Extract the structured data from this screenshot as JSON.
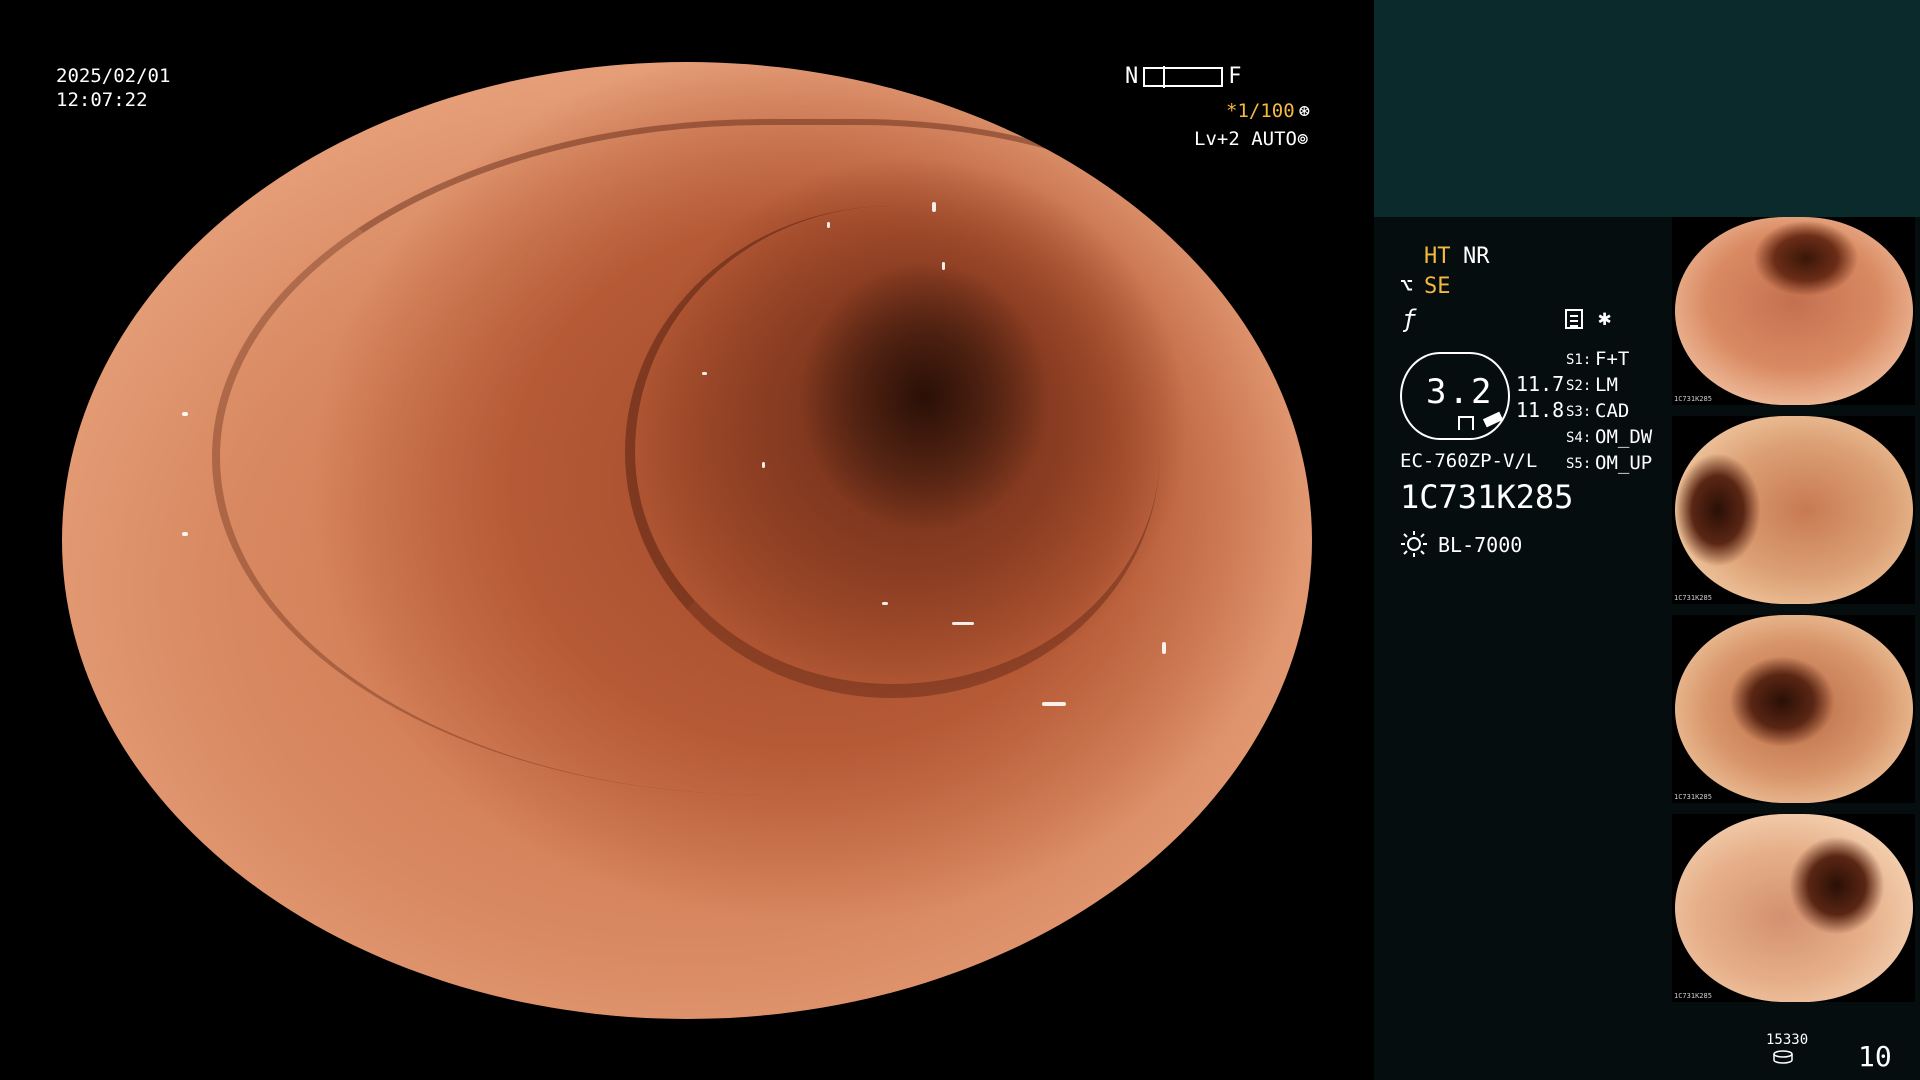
{
  "overlay": {
    "date": "2025/02/01",
    "time": "12:07:22",
    "near_label": "N",
    "far_label": "F",
    "shutter": "*1/100",
    "level": "Lv+2",
    "auto": "AUTO"
  },
  "status": {
    "ht": "HT",
    "nr": "NR",
    "se": "SE",
    "gauge_value": "3.2",
    "value_top": "11.7",
    "value_bottom": "11.8",
    "scope_model": "EC-760ZP-V/L",
    "serial": "1C731K285",
    "light_source": "BL-7000"
  },
  "switches": [
    {
      "key": "S1:",
      "value": "F+T"
    },
    {
      "key": "S2:",
      "value": "LM"
    },
    {
      "key": "S3:",
      "value": "CAD"
    },
    {
      "key": "S4:",
      "value": "OM_DW"
    },
    {
      "key": "S5:",
      "value": "OM_UP"
    }
  ],
  "thumbnails": [
    {
      "caption": "1C731K285"
    },
    {
      "caption": "1C731K285"
    },
    {
      "caption": "1C731K285"
    },
    {
      "caption": "1C731K285"
    }
  ],
  "footer": {
    "storage": "15330",
    "count": "10"
  },
  "icons": [
    "shutter-icon",
    "auto-icon",
    "scissor-icon",
    "f-icon",
    "document-icon",
    "star-icon",
    "light-icon",
    "disk-icon"
  ],
  "colors": {
    "accent": "#f4b941",
    "panel": "#0b2a2c",
    "mucosa": "#c96d46"
  }
}
